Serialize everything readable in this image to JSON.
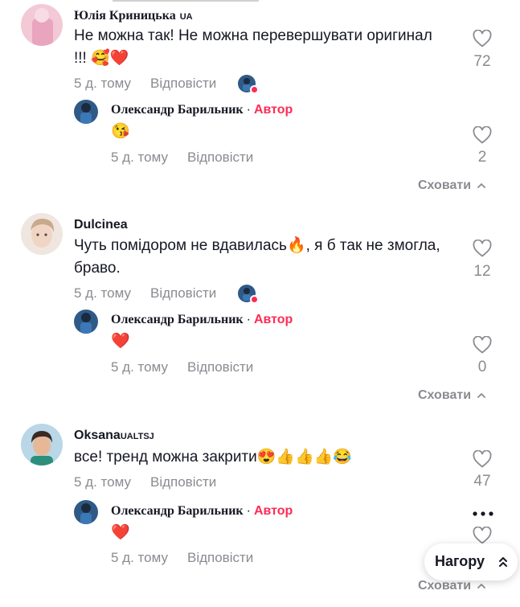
{
  "comments": [
    {
      "username": "Юлія Криницька",
      "badge": "UA",
      "text": "Не можна так! Не можна перевершувати оригинал !!! 🥰❤️",
      "time": "5 д. тому",
      "reply_label": "Відповісти",
      "likes": "72",
      "reply": {
        "author": "Олександр Барильник",
        "separator": "·",
        "author_tag": "Автор",
        "text": "😘",
        "time": "5 д. тому",
        "reply_label": "Відповісти",
        "likes": "2"
      },
      "hide_label": "Сховати"
    },
    {
      "username": "Dulcinea",
      "text": "Чуть помідором не вдавилась🔥, я б так не змогла, браво.",
      "time": "5 д. тому",
      "reply_label": "Відповісти",
      "likes": "12",
      "reply": {
        "author": "Олександр Барильник",
        "separator": "·",
        "author_tag": "Автор",
        "text": "❤️",
        "time": "5 д. тому",
        "reply_label": "Відповісти",
        "likes": "0"
      },
      "hide_label": "Сховати"
    },
    {
      "username": "Oksana",
      "badge": "UALTSJ",
      "text": "все! тренд можна закрити😍👍👍👍😂",
      "time": "5 д. тому",
      "reply_label": "Відповісти",
      "likes": "47",
      "reply": {
        "author": "Олександр Барильник",
        "separator": "·",
        "author_tag": "Автор",
        "text": "❤️",
        "time": "5 д. тому",
        "reply_label": "Відповісти"
      },
      "hide_label": "Сховати"
    }
  ],
  "scroll_top_label": "Нагору",
  "colors": {
    "accent": "#fe2c55",
    "muted": "#8a8b91",
    "text": "#161823"
  },
  "icons": [
    "heart-icon",
    "chevron-up-icon",
    "more-icon",
    "double-chevron-up-icon"
  ]
}
